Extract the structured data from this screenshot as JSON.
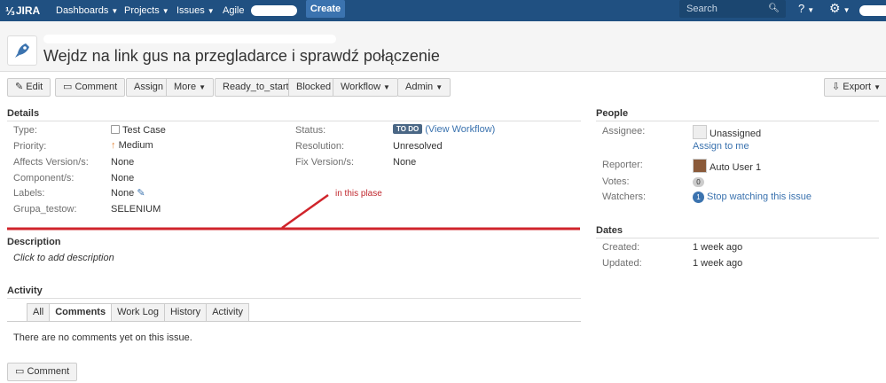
{
  "nav": {
    "logo": "JIRA",
    "items": [
      "Dashboards",
      "Projects",
      "Issues",
      "Agile"
    ],
    "create": "Create",
    "search_placeholder": "Search"
  },
  "issue": {
    "summary": "Wejdz na link gus na przegladarce i sprawdź połączenie"
  },
  "toolbar": {
    "edit": "Edit",
    "comment": "Comment",
    "assign": "Assign",
    "more": "More",
    "ready": "Ready_to_start",
    "blocked": "Blocked",
    "workflow": "Workflow",
    "admin": "Admin",
    "export": "Export"
  },
  "details": {
    "title": "Details",
    "left": [
      {
        "label": "Type:",
        "value": "Test Case"
      },
      {
        "label": "Priority:",
        "value": "Medium"
      },
      {
        "label": "Affects Version/s:",
        "value": "None"
      },
      {
        "label": "Component/s:",
        "value": "None"
      },
      {
        "label": "Labels:",
        "value": "None"
      },
      {
        "label": "Grupa_testow:",
        "value": "SELENIUM"
      }
    ],
    "status_label": "Status:",
    "status_lozenge": "TO DO",
    "view_workflow": "(View Workflow)",
    "resolution_label": "Resolution:",
    "resolution_value": "Unresolved",
    "fix_label": "Fix Version/s:",
    "fix_value": "None"
  },
  "annotation": {
    "text": "in this plase",
    "color": "#d0242b"
  },
  "description": {
    "title": "Description",
    "placeholder": "Click to add description"
  },
  "activity": {
    "title": "Activity",
    "tabs": [
      "All",
      "Comments",
      "Work Log",
      "History",
      "Activity"
    ],
    "empty": "There are no comments yet on this issue.",
    "comment_button": "Comment"
  },
  "people": {
    "title": "People",
    "assignee_label": "Assignee:",
    "assignee_value": "Unassigned",
    "assign_to_me": "Assign to me",
    "reporter_label": "Reporter:",
    "reporter_value": "Auto User 1",
    "votes_label": "Votes:",
    "votes_value": "0",
    "watchers_label": "Watchers:",
    "watchers_count": "1",
    "watchers_link": "Stop watching this issue"
  },
  "dates": {
    "title": "Dates",
    "created_label": "Created:",
    "created_value": "1 week ago",
    "updated_label": "Updated:",
    "updated_value": "1 week ago"
  }
}
